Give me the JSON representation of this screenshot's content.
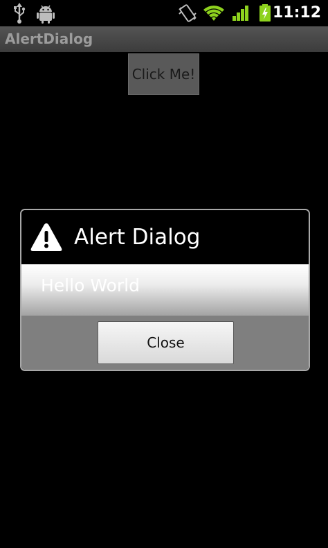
{
  "status_bar": {
    "time": "11:12",
    "icons": [
      "usb-icon",
      "android-debug-icon",
      "vibrate-icon",
      "wifi-icon",
      "signal-icon",
      "battery-charging-icon"
    ],
    "accent_color": "#8ed21e"
  },
  "app": {
    "title": "AlertDialog"
  },
  "main": {
    "click_button_label": "Click Me!"
  },
  "dialog": {
    "title": "Alert Dialog",
    "icon": "warning-icon",
    "message": "Hello World",
    "close_label": "Close"
  }
}
